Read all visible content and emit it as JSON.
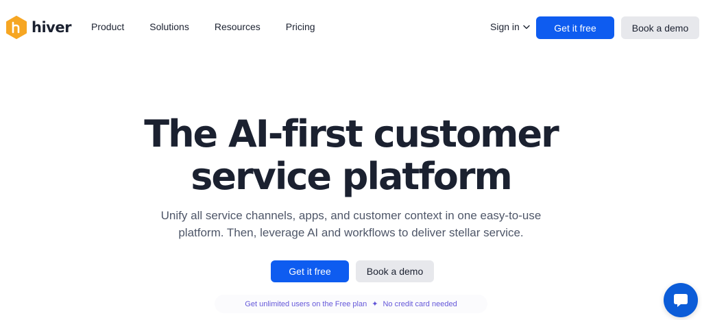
{
  "brand": {
    "name": "hiver",
    "color": "#f6a623"
  },
  "nav": {
    "items": [
      "Product",
      "Solutions",
      "Resources",
      "Pricing"
    ]
  },
  "header_actions": {
    "sign_in": "Sign in",
    "get_free": "Get it free",
    "book_demo": "Book a demo"
  },
  "hero": {
    "title_line1": "The AI-first customer",
    "title_line2": "service platform",
    "subtitle_line1": "Unify all service channels, apps, and customer context in one easy-to-use",
    "subtitle_line2": "platform. Then, leverage AI and workflows to deliver stellar service.",
    "cta_primary": "Get it free",
    "cta_secondary": "Book a demo",
    "note_left": "Get unlimited users on the Free plan",
    "note_right": "No credit card needed"
  },
  "colors": {
    "primary": "#0e5cf0",
    "secondary_bg": "#e7e8ec",
    "text": "#1b2130",
    "note_text": "#6457d9",
    "chat": "#0b5cd8"
  },
  "icons": {
    "logo": "hiver-hexagon-icon",
    "sign_in_chevron": "chevron-down-icon",
    "note_separator": "sparkle-icon",
    "chat": "chat-bubble-icon"
  }
}
